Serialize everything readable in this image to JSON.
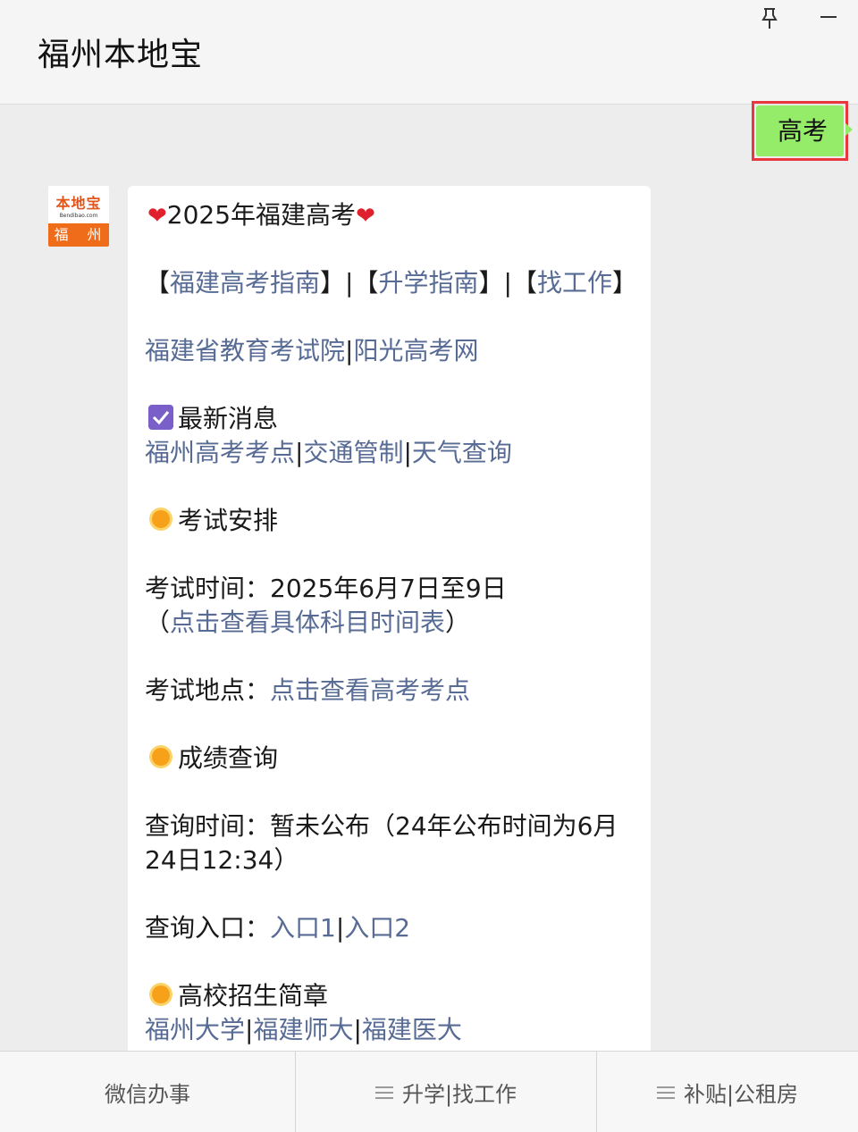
{
  "header": {
    "title": "福州本地宝"
  },
  "sent_message": {
    "text": "高考"
  },
  "avatar": {
    "brand": "本地宝",
    "url": "Bendibao.com",
    "city": "福 州"
  },
  "message": {
    "headline": "2025年福建高考",
    "nav_links": {
      "l1": "福建高考指南",
      "l2": "升学指南",
      "l3": "找工作"
    },
    "site_links": {
      "l1": "福建省教育考试院",
      "l2": "阳光高考网"
    },
    "latest": {
      "heading": "最新消息",
      "l1": "福州高考考点",
      "l2": "交通管制",
      "l3": "天气查询"
    },
    "exam": {
      "heading": "考试安排",
      "time_label": "考试时间：",
      "time_value": "2025年6月7日至9日",
      "schedule_link": "点击查看具体科目时间表",
      "place_label": "考试地点：",
      "place_link": "点击查看高考考点"
    },
    "score": {
      "heading": "成绩查询",
      "time_line1": "查询时间：暂未公布（24年公布时间为6月",
      "time_line2": "24日12:34）",
      "entry_label": "查询入口：",
      "entry1": "入口1",
      "entry2": "入口2"
    },
    "admission": {
      "heading": "高校招生简章",
      "l1": "福州大学",
      "l2": "福建师大",
      "l3": "福建医大"
    }
  },
  "tabbar": {
    "tab1": "微信办事",
    "tab2": "升学|找工作",
    "tab3": "补贴|公租房"
  },
  "colors": {
    "link": "#576b95",
    "sent_bubble": "#95ec69",
    "highlight_border": "#e8383d",
    "checkbox": "#7b5fc9",
    "sun": "#f7a11a"
  }
}
